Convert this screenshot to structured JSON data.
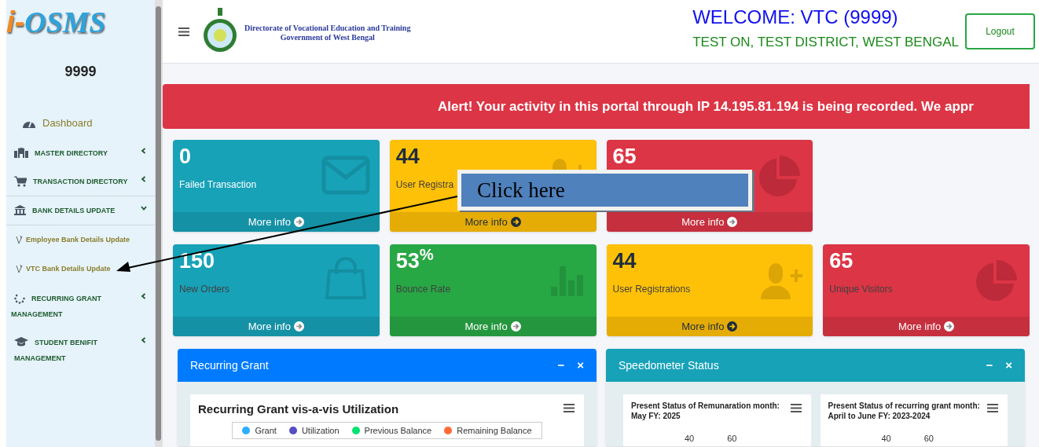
{
  "sidebar": {
    "logo": {
      "prefix": "i-",
      "name": "OSMS"
    },
    "user_code": "9999",
    "items": [
      {
        "label": "Dashboard",
        "kind": "dashboard"
      },
      {
        "label": "MASTER DIRECTORY",
        "kind": "menu",
        "expanded": false
      },
      {
        "label": "TRANSACTION DIRECTORY",
        "kind": "menu",
        "expanded": false
      },
      {
        "label": "BANK DETAILS UPDATE",
        "kind": "menu",
        "expanded": true
      },
      {
        "label": "Employee Bank Details Update",
        "kind": "submenu"
      },
      {
        "label": "VTC Bank Details Update",
        "kind": "submenu"
      },
      {
        "label": "RECURRING GRANT MANAGEMENT",
        "kind": "menu",
        "expanded": false
      },
      {
        "label": "STUDENT BENIFIT MANAGEMENT",
        "kind": "menu",
        "expanded": false
      }
    ]
  },
  "header": {
    "org_line_1": "Directorate of Vocational Education and Training",
    "org_line_2": "Government of West Bengal",
    "welcome": "WELCOME: VTC (9999)",
    "location": "TEST ON, TEST DISTRICT, WEST BENGAL",
    "logout": "Logout"
  },
  "alert": "Alert! Your activity in this portal through IP 14.195.81.194 is being recorded. We appr",
  "cards": [
    {
      "value": "0",
      "label": "Failed Transaction",
      "footer": "More info",
      "kind": "info",
      "label_faded": false
    },
    {
      "value": "44",
      "label": "User Registra",
      "footer": "More info",
      "kind": "warning",
      "label_faded": true
    },
    {
      "value": "65",
      "footer": "More info",
      "kind": "danger"
    },
    {
      "value": "150",
      "label": "New Orders",
      "footer": "More info",
      "kind": "info",
      "label_faded": true
    },
    {
      "value": "53$^{%}$",
      "label": "Bounce Rate",
      "footer": "More info",
      "kind": "success",
      "label_faded": true
    },
    {
      "value": "44",
      "label": "User Registrations",
      "footer": "More info",
      "kind": "warning",
      "label_faded": true
    },
    {
      "value": "65",
      "label": "Unique Visitors",
      "footer": "More info",
      "kind": "danger",
      "label_faded": true
    }
  ],
  "panels": [
    {
      "title": "Recurring Grant",
      "kind": "primary",
      "minimize": "−",
      "close": "×",
      "charts": [
        {
          "title": "Recurring Grant vis-a-vis Utilization",
          "legend": [
            {
              "name": "Grant",
              "color": "#2caffe"
            },
            {
              "name": "Utilization",
              "color": "#544fc5"
            },
            {
              "name": "Previous Balance",
              "color": "#00e272"
            },
            {
              "name": "Remaining Balance",
              "color": "#fe6a35"
            }
          ]
        }
      ]
    },
    {
      "title": "Speedometer Status",
      "kind": "info",
      "minimize": "−",
      "close": "×",
      "charts": [
        {
          "title": "Present Status of Remunaration month: May FY: 2025",
          "ticks": [
            "40",
            "60"
          ]
        },
        {
          "title": "Present Status of recurring grant month: April to June FY: 2023-2024",
          "ticks": [
            "40",
            "60"
          ]
        }
      ]
    }
  ],
  "callout": {
    "text": "Click here"
  }
}
